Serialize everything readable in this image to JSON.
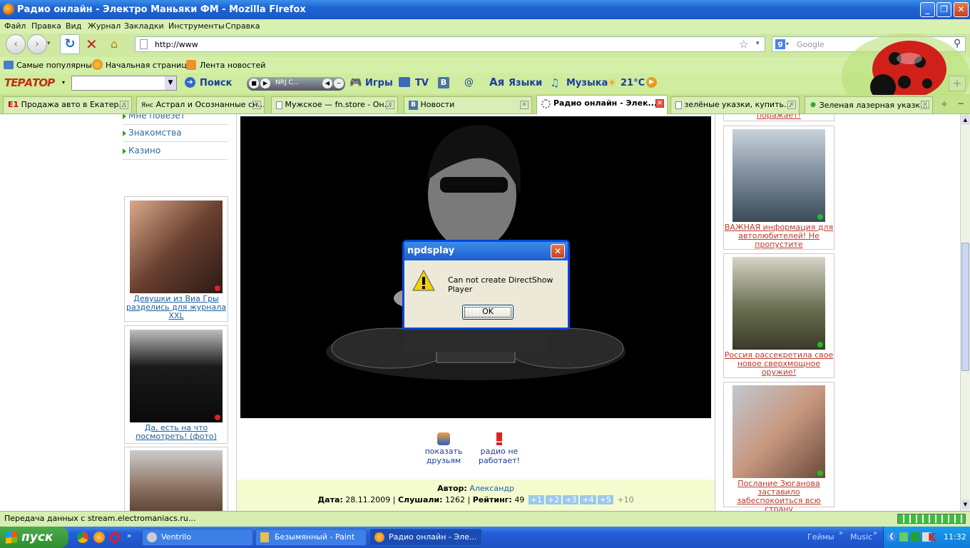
{
  "window": {
    "title": "Радио онлайн - Электро Маньяки ФМ - Mozilla Firefox",
    "min": "_",
    "max": "❐",
    "close": "✕"
  },
  "menu": [
    "Файл",
    "Правка",
    "Вид",
    "Журнал",
    "Закладки",
    "Инструменты",
    "Справка"
  ],
  "nav": {
    "url": "http://www",
    "search_placeholder": "Google"
  },
  "bookmarks": [
    "Самые популярные",
    "Начальная страница",
    "Лента новостей"
  ],
  "toolbar": {
    "logo": "ТЕРАТОР",
    "search": "Поиск",
    "radio_station": "NRJ C...",
    "games": "Игры",
    "tv": "TV",
    "languages": "Языки",
    "music": "Музыка",
    "weather": "21°C"
  },
  "tabs": [
    {
      "label": "Продажа авто в Екатер...",
      "icon": "E1"
    },
    {
      "label": "Астрал и Осознанные сн...",
      "icon": "Янс"
    },
    {
      "label": "Мужское — fn.store - Он...",
      "icon": "page"
    },
    {
      "label": "Новости",
      "icon": "B"
    },
    {
      "label": "Радио онлайн - Элек...",
      "icon": "loading"
    },
    {
      "label": "зелёные указки, купить...",
      "icon": "page"
    },
    {
      "label": "Зеленая лазерная указк...",
      "icon": "star"
    }
  ],
  "sidebar": {
    "links": [
      "Мне повезет",
      "Знакомства",
      "Казино"
    ]
  },
  "left_ads": [
    "Девушки из Виа Гры разделись для журнала XXL",
    "Да, есть на что посмотреть! (фото)"
  ],
  "right_ads": {
    "top_cut": "поражает!",
    "items": [
      "ВАЖНАЯ информация для автолюбителей! Не пропустите",
      "Россия рассекретила свое новое сверхмощное оружие!",
      "Послание Зюганова заставило забеспокоиться всю страну"
    ]
  },
  "actions": {
    "share": "показать друзьям",
    "broken": "радио не работает!"
  },
  "meta": {
    "author_label": "Автор:",
    "author": "Александр",
    "date_label": "Дата:",
    "date": "28.11.2009",
    "listens_label": "Слушали:",
    "listens": "1262",
    "rating_label": "Рейтинг:",
    "rating": "49",
    "votes": [
      "+1",
      "+2",
      "+3",
      "+4",
      "+5",
      "+10"
    ]
  },
  "dialog": {
    "title": "npdsplay",
    "message": "Can not create DirectShow Player",
    "ok": "OK"
  },
  "status": {
    "text": "Передача данных с stream.electromaniacs.ru...",
    "progress": 1.0
  },
  "taskbar": {
    "start": "пуск",
    "tasks": [
      "Ventrilo",
      "Безымянный - Paint",
      "Радио онлайн - Эле..."
    ],
    "tray_labels": [
      "Геймы",
      "Music"
    ],
    "clock": "11:32"
  },
  "colors": {
    "accent": "#1f63d3",
    "toolbar_bg": "#cfeaa0",
    "link": "#2b6ea3"
  }
}
